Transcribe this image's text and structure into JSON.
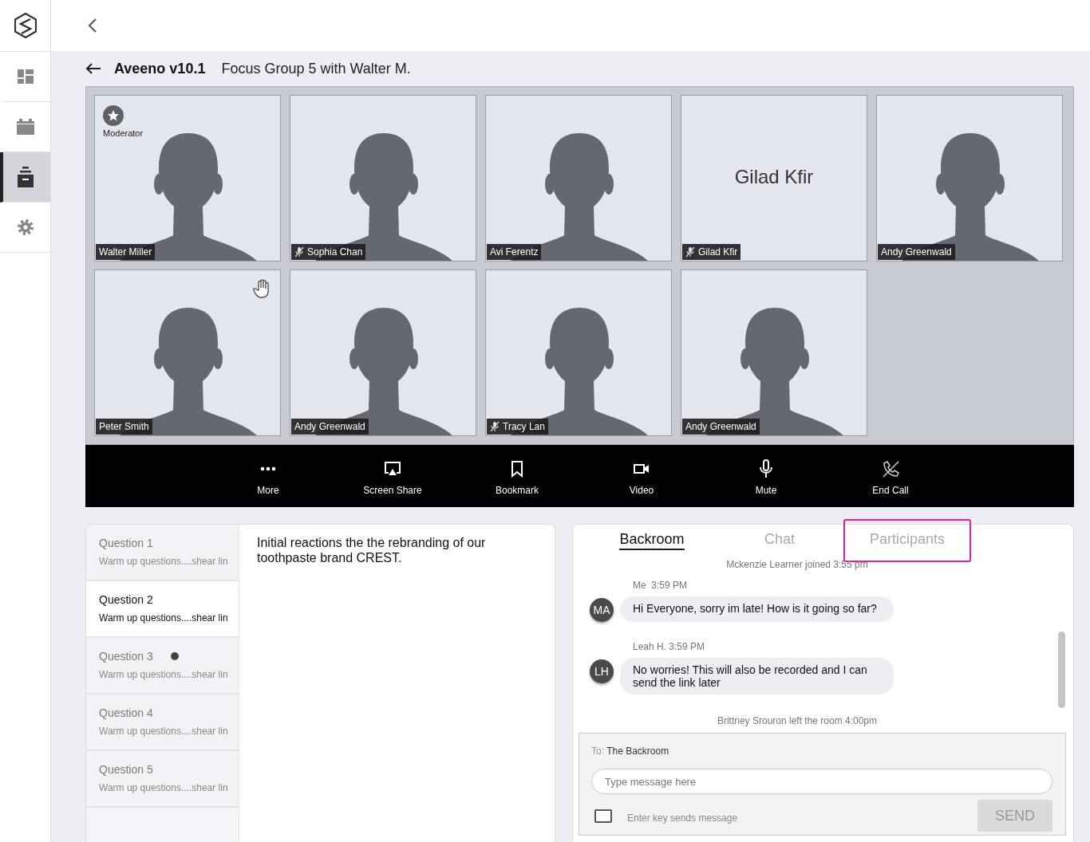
{
  "sidebar": {
    "items": [
      {
        "kind": "dashboard",
        "selected": false
      },
      {
        "kind": "calendar",
        "selected": false
      },
      {
        "kind": "archive",
        "selected": true
      },
      {
        "kind": "settings",
        "selected": false
      }
    ]
  },
  "header": {
    "title": "Aveeno v10.1",
    "subtitle": "Focus Group 5 with Walter M."
  },
  "tiles": [
    {
      "kind": "video",
      "name": "Walter Miller",
      "role": "Moderator",
      "muted": false,
      "hand_raised": false
    },
    {
      "kind": "video",
      "name": "Sophia Chan",
      "muted": true,
      "hand_raised": false
    },
    {
      "kind": "video",
      "name": "Avi Ferentz",
      "muted": false,
      "hand_raised": false
    },
    {
      "kind": "name",
      "display_name": "Gilad Kfir",
      "name": "Gilad Kfir",
      "muted": true,
      "hand_raised": false
    },
    {
      "kind": "video",
      "name": "Andy Greenwald",
      "muted": false,
      "hand_raised": false
    },
    {
      "kind": "video",
      "name": "Peter Smith",
      "muted": false,
      "hand_raised": true
    },
    {
      "kind": "video",
      "name": "Andy Greenwald",
      "muted": false,
      "hand_raised": false
    },
    {
      "kind": "video",
      "name": "Tracy Lan",
      "muted": true,
      "hand_raised": false
    },
    {
      "kind": "video",
      "name": "Andy Greenwald",
      "muted": false,
      "hand_raised": false
    }
  ],
  "toolbar": [
    {
      "kind": "more",
      "label": "More"
    },
    {
      "kind": "screen_share",
      "label": "Screen Share"
    },
    {
      "kind": "bookmark",
      "label": "Bookmark"
    },
    {
      "kind": "video",
      "label": "Video"
    },
    {
      "kind": "mic",
      "label": "Mute"
    },
    {
      "kind": "end_call",
      "label": "End Call"
    }
  ],
  "questions": [
    {
      "title": "Question 1",
      "subtitle": "Warm up questions....shear lin",
      "selected": false,
      "unread": false
    },
    {
      "title": "Question 2",
      "subtitle": "Warm up questions....shear lin",
      "selected": true,
      "unread": false
    },
    {
      "title": "Question 3",
      "subtitle": "Warm up questions....shear lin",
      "selected": false,
      "unread": true
    },
    {
      "title": "Question 4",
      "subtitle": "Warm up questions....shear lin",
      "selected": false,
      "unread": false
    },
    {
      "title": "Question 5",
      "subtitle": "Warm up questions....shear lin",
      "selected": false,
      "unread": false
    }
  ],
  "question_text": "Initial reactions the the rebranding of our toothpaste brand CREST.",
  "chat": {
    "tabs": [
      {
        "label": "Backroom",
        "selected": true,
        "highlighted": false
      },
      {
        "label": "Chat",
        "selected": false,
        "highlighted": false
      },
      {
        "label": "Participants",
        "selected": false,
        "highlighted": true
      }
    ],
    "feed": [
      {
        "kind": "system",
        "text": "Mckenzie Learner joined 3:55 pm"
      },
      {
        "kind": "message",
        "meta": "Me  3:59 PM",
        "initials": "MA",
        "text": "Hi Everyone, sorry im late! How is it going so far?"
      },
      {
        "kind": "message",
        "meta": "Leah H. 3:59 PM",
        "initials": "LH",
        "text": "No worries! This will also be recorded and I can send the link later"
      },
      {
        "kind": "system",
        "text": "Brittney Srouron left the room 4:00pm"
      }
    ],
    "compose": {
      "to_label": "To:",
      "to": "The Backroom",
      "placeholder": "Type message here",
      "enter_label": "Enter key sends message",
      "enter_checked": false,
      "send_label": "SEND",
      "send_disabled": true
    }
  }
}
